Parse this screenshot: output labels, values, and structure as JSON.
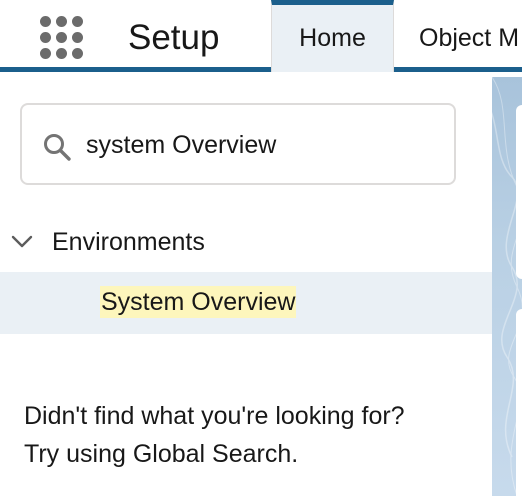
{
  "header": {
    "app_launcher_icon": "app-launcher-grid-icon",
    "title": "Setup",
    "tabs": [
      {
        "label": "Home",
        "active": true
      },
      {
        "label": "Object M",
        "active": false
      }
    ],
    "accent_color": "#1b5f8c"
  },
  "sidebar": {
    "search": {
      "icon": "search-icon",
      "value": "system Overview",
      "placeholder": ""
    },
    "section": {
      "icon": "chevron-down-icon",
      "label": "Environments",
      "expanded": true
    },
    "items": [
      {
        "label": "System Overview",
        "highlight_color": "#fdf6bc",
        "selected_bg": "#eaf0f5"
      }
    ],
    "help_text_line1": "Didn't find what you're looking for?",
    "help_text_line2": "Try using Global Search."
  }
}
